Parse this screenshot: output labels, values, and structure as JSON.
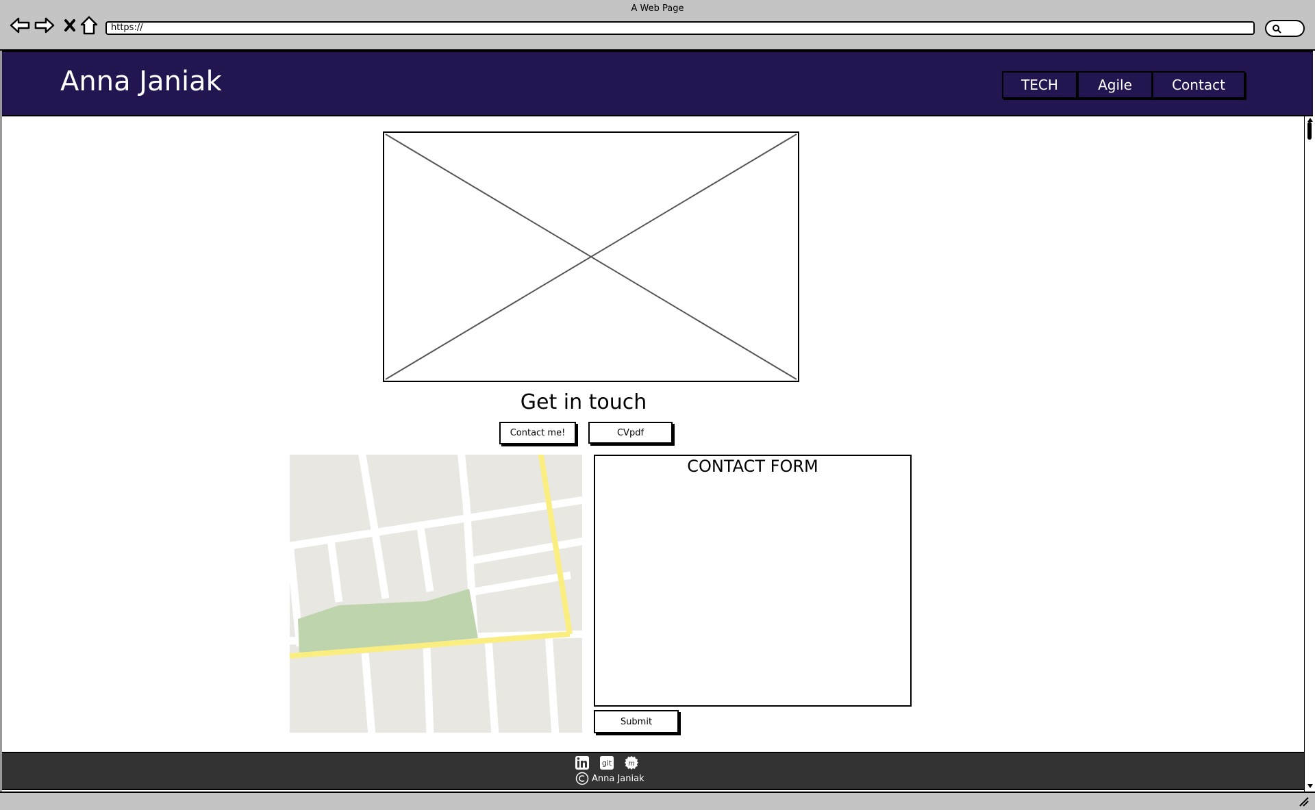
{
  "browser": {
    "window_title": "A Web Page",
    "url": "https://",
    "icons": [
      "back-arrow-icon",
      "forward-arrow-icon",
      "close-x-icon",
      "home-icon",
      "search-icon"
    ]
  },
  "header": {
    "brand": "Anna Janiak",
    "nav": [
      {
        "label": "TECH"
      },
      {
        "label": "Agile"
      },
      {
        "label": "Contact"
      }
    ],
    "background_color": "#23154f"
  },
  "main": {
    "hero_image": "image-placeholder",
    "section_title": "Get in touch",
    "buttons": {
      "contact_label": "Contact me!",
      "cv_label": "CVpdf"
    },
    "map": "map-placeholder",
    "contact_form": {
      "title": "CONTACT FORM",
      "submit_label": "Submit"
    }
  },
  "footer": {
    "icons": [
      "linkedin-icon",
      "git-icon",
      "meetup-icon"
    ],
    "copyright_name": "Anna Janiak",
    "background_color": "#333333"
  }
}
